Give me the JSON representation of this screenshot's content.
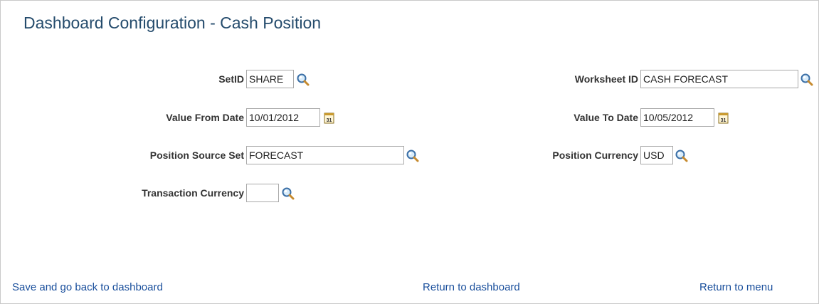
{
  "page": {
    "title": "Dashboard Configuration - Cash Position"
  },
  "form": {
    "setid": {
      "label": "SetID",
      "value": "SHARE"
    },
    "worksheet_id": {
      "label": "Worksheet ID",
      "value": "CASH FORECAST"
    },
    "value_from_date": {
      "label": "Value From Date",
      "value": "10/01/2012"
    },
    "value_to_date": {
      "label": "Value To Date",
      "value": "10/05/2012"
    },
    "position_source_set": {
      "label": "Position Source Set",
      "value": "FORECAST"
    },
    "position_currency": {
      "label": "Position Currency",
      "value": "USD"
    },
    "transaction_currency": {
      "label": "Transaction Currency",
      "value": ""
    }
  },
  "links": {
    "save_back": "Save and go back to dashboard",
    "return_dashboard": "Return to dashboard",
    "return_menu": "Return to menu"
  },
  "icons": {
    "lookup": "magnifier-icon",
    "calendar": "calendar-icon",
    "calendar_text": "31"
  },
  "colors": {
    "title": "#244b6c",
    "link": "#1a4f9c",
    "field_border": "#a9a9a9"
  }
}
